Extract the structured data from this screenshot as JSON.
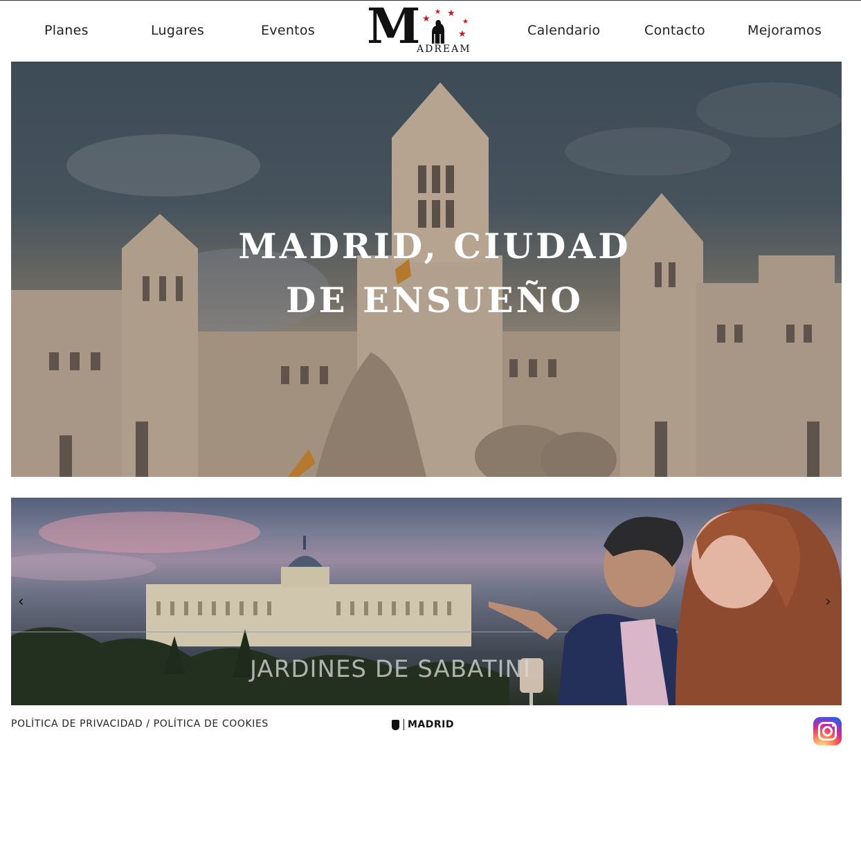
{
  "nav": {
    "items": [
      {
        "label": "Planes"
      },
      {
        "label": "Lugares"
      },
      {
        "label": "Eventos"
      },
      {
        "label": "Calendario"
      },
      {
        "label": "Contacto"
      },
      {
        "label": "Mejoramos"
      }
    ],
    "logo": {
      "initial": "M",
      "rest": "ADREAM",
      "star_color": "#d0121b"
    }
  },
  "hero": {
    "title_line1": "MADRID, CIUDAD",
    "title_line2": "DE ENSUEÑO"
  },
  "carousel": {
    "prev_arrow": "‹",
    "next_arrow": "›",
    "sign_text": "JARDINES DE SABATINI"
  },
  "footer": {
    "privacy_label": "POLÍTICA DE PRIVACIDAD",
    "separator": " / ",
    "cookies_label": "POLÍTICA DE COOKIES",
    "madrid_label": "MADRID",
    "social_icon": "instagram-icon"
  }
}
